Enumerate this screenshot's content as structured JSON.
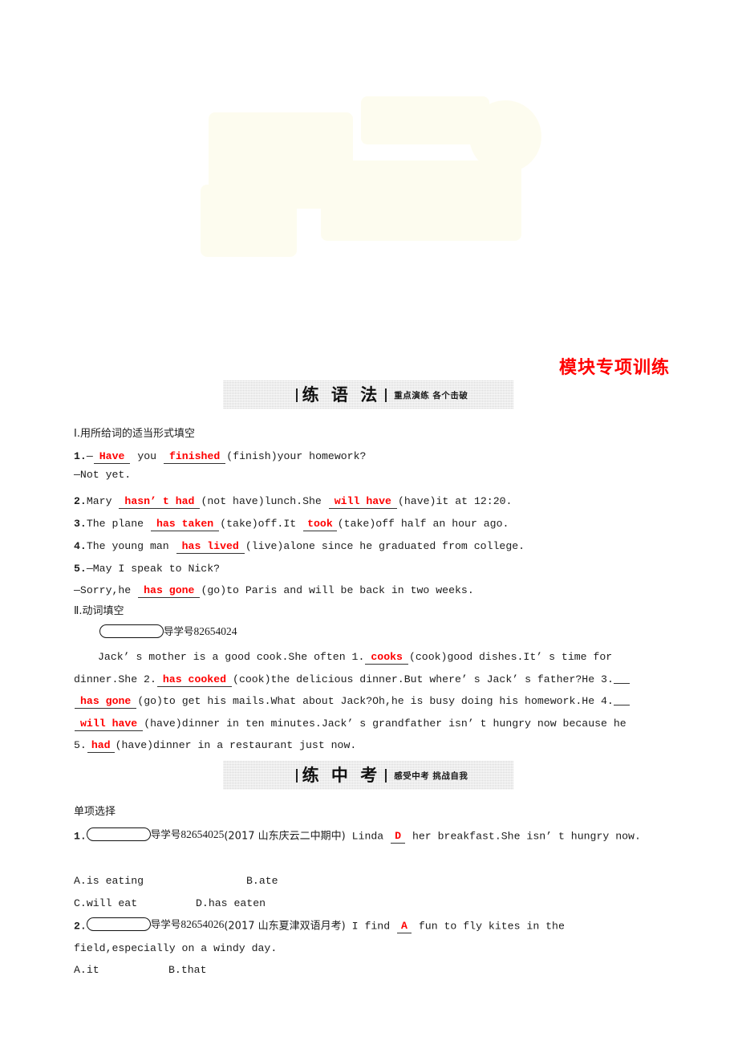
{
  "page": {
    "title": "模块专项训练",
    "title_color": "#ff0000",
    "answer_color": "#ff0000",
    "banner_bg": "#d9d9d9"
  },
  "banners": [
    {
      "id": "grammar",
      "title": "练 语 法",
      "subtitle": "重点演练  各个击破"
    },
    {
      "id": "exam",
      "title": "练 中 考",
      "subtitle": "感受中考  挑战自我"
    }
  ],
  "section1": {
    "heading": "Ⅰ.用所给词的适当形式填空",
    "questions": [
      {
        "num": "1.",
        "lines": [
          [
            {
              "t": "text",
              "v": "—"
            },
            {
              "t": "ans",
              "v": "Have"
            },
            {
              "t": "text",
              "v": " you "
            },
            {
              "t": "ans",
              "v": "finished"
            },
            {
              "t": "text",
              "v": "(finish)your homework?"
            }
          ],
          [
            {
              "t": "text",
              "v": "—Not yet."
            }
          ]
        ]
      },
      {
        "num": "2.",
        "lines": [
          [
            {
              "t": "text",
              "v": "Mary "
            },
            {
              "t": "ans",
              "v": "hasn’ t had"
            },
            {
              "t": "text",
              "v": "(not have)lunch.She "
            },
            {
              "t": "ans",
              "v": "will have"
            },
            {
              "t": "text",
              "v": "(have)it at 12:20."
            }
          ]
        ]
      },
      {
        "num": "3.",
        "lines": [
          [
            {
              "t": "text",
              "v": "The plane "
            },
            {
              "t": "ans",
              "v": "has taken"
            },
            {
              "t": "text",
              "v": "(take)off.It "
            },
            {
              "t": "ans",
              "v": "took"
            },
            {
              "t": "text",
              "v": "(take)off half an hour ago."
            }
          ]
        ]
      },
      {
        "num": "4.",
        "lines": [
          [
            {
              "t": "text",
              "v": "The young man "
            },
            {
              "t": "ans",
              "v": "has lived"
            },
            {
              "t": "text",
              "v": "(live)alone since he graduated from college."
            }
          ]
        ]
      },
      {
        "num": "5.",
        "lines": [
          [
            {
              "t": "text",
              "v": "—May I speak to Nick?"
            }
          ],
          [
            {
              "t": "text",
              "v": "—Sorry,he "
            },
            {
              "t": "ans",
              "v": "has gone"
            },
            {
              "t": "text",
              "v": "(go)to Paris and will be back in two weeks."
            }
          ]
        ]
      }
    ]
  },
  "section2": {
    "heading": "Ⅱ.动词填空",
    "badge": {
      "label": "导学号",
      "number": "82654024"
    },
    "passage": [
      {
        "t": "indent"
      },
      {
        "t": "text",
        "v": "Jack’ s mother is a good cook.She often 1."
      },
      {
        "t": "ans",
        "v": "cooks"
      },
      {
        "t": "text",
        "v": "(cook)good dishes.It’ s time for dinner.She 2."
      },
      {
        "t": "ans",
        "v": "has cooked"
      },
      {
        "t": "text",
        "v": "(cook)the delicious dinner.But where’ s Jack’ s father?He 3."
      },
      {
        "t": "blank"
      },
      {
        "t": "ans",
        "v": "has gone"
      },
      {
        "t": "text",
        "v": "(go)to get his mails.What about Jack?Oh,he is busy doing his homework.He 4."
      },
      {
        "t": "blank"
      },
      {
        "t": "ans",
        "v": "will have"
      },
      {
        "t": "text",
        "v": "(have)dinner in ten minutes.Jack’ s grandfather isn’ t hungry now because he 5."
      },
      {
        "t": "ans",
        "v": "had"
      },
      {
        "t": "text",
        "v": "(have)dinner in a restaurant just now."
      }
    ]
  },
  "section3": {
    "heading": "单项选择",
    "questions": [
      {
        "num": "1.",
        "badge": {
          "label": "导学号",
          "number": "82654025"
        },
        "source": "(2017 山东庆云二中期中)",
        "stem_before": " Linda ",
        "answer": "D",
        "stem_after": " her breakfast.She isn’ t hungry now.",
        "options": [
          {
            "key": "A.",
            "text": "is eating"
          },
          {
            "key": "B.",
            "text": "ate"
          },
          {
            "key": "C.",
            "text": "will eat"
          },
          {
            "key": "D.",
            "text": "has eaten"
          }
        ]
      },
      {
        "num": "2.",
        "badge": {
          "label": "导学号",
          "number": "82654026"
        },
        "source": "(2017 山东夏津双语月考)",
        "stem_before": " I find ",
        "answer": "A",
        "stem_after": " fun to fly kites in the field,especially on a windy day.",
        "options": [
          {
            "key": "A.",
            "text": "it"
          },
          {
            "key": "B.",
            "text": "that"
          }
        ]
      }
    ]
  }
}
